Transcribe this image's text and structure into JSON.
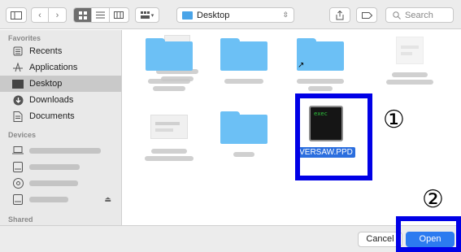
{
  "toolbar": {
    "location_label": "Desktop",
    "search_placeholder": "Search"
  },
  "sidebar": {
    "favorites_heading": "Favorites",
    "favorites": [
      {
        "label": "Recents",
        "icon": "recents-icon"
      },
      {
        "label": "Applications",
        "icon": "applications-icon"
      },
      {
        "label": "Desktop",
        "icon": "desktop-icon",
        "selected": true
      },
      {
        "label": "Downloads",
        "icon": "downloads-icon"
      },
      {
        "label": "Documents",
        "icon": "documents-icon"
      }
    ],
    "devices_heading": "Devices",
    "shared_heading": "Shared"
  },
  "content": {
    "selected_file_label": "VERSAW.PPD",
    "exec_icon_text": "exec"
  },
  "annotations": {
    "marker_1": "①",
    "marker_2": "②",
    "highlight_color": "#0000e6"
  },
  "buttons": {
    "cancel_label": "Cancel",
    "open_label": "Open"
  }
}
